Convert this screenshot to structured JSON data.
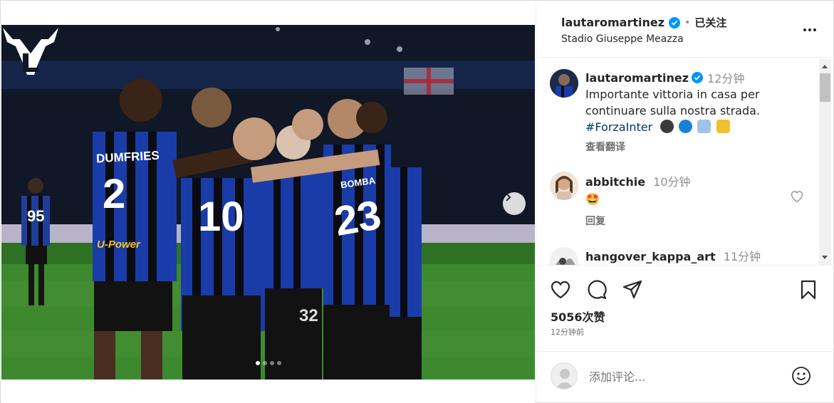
{
  "colors": {
    "accent": "#0095f6",
    "link": "#00376b",
    "muted": "#737373",
    "border": "#dbdbdb"
  },
  "media": {
    "logo": "ML",
    "next_icon": "chevron-right-icon",
    "carousel_count": 4,
    "carousel_active": 0,
    "jerseys": [
      "DUMFRIES",
      "2",
      "10",
      "BOMBA",
      "23",
      "95",
      "32",
      "U-Power"
    ]
  },
  "header": {
    "username": "lautaromartinez",
    "separator": "•",
    "follow_status": "已关注",
    "location": "Stadio Giuseppe Meazza",
    "more_icon": "more-horizontal-icon"
  },
  "caption": {
    "username": "lautaromartinez",
    "time": "12分钟",
    "text_line1": "Importante vittoria in casa per",
    "text_line2": "continuare sulla nostra strada.",
    "hashtag": "#ForzaInter",
    "translate": "查看翻译"
  },
  "comments": [
    {
      "username": "abbitchie",
      "time": "10分钟",
      "text": "🤩",
      "reply": "回复"
    },
    {
      "username": "hangover_kappa_art",
      "time": "11分钟",
      "text": ""
    }
  ],
  "actions": {
    "likes": "5056次赞",
    "posted_ago": "12分钟前"
  },
  "add_comment": {
    "placeholder": "添加评论..."
  }
}
